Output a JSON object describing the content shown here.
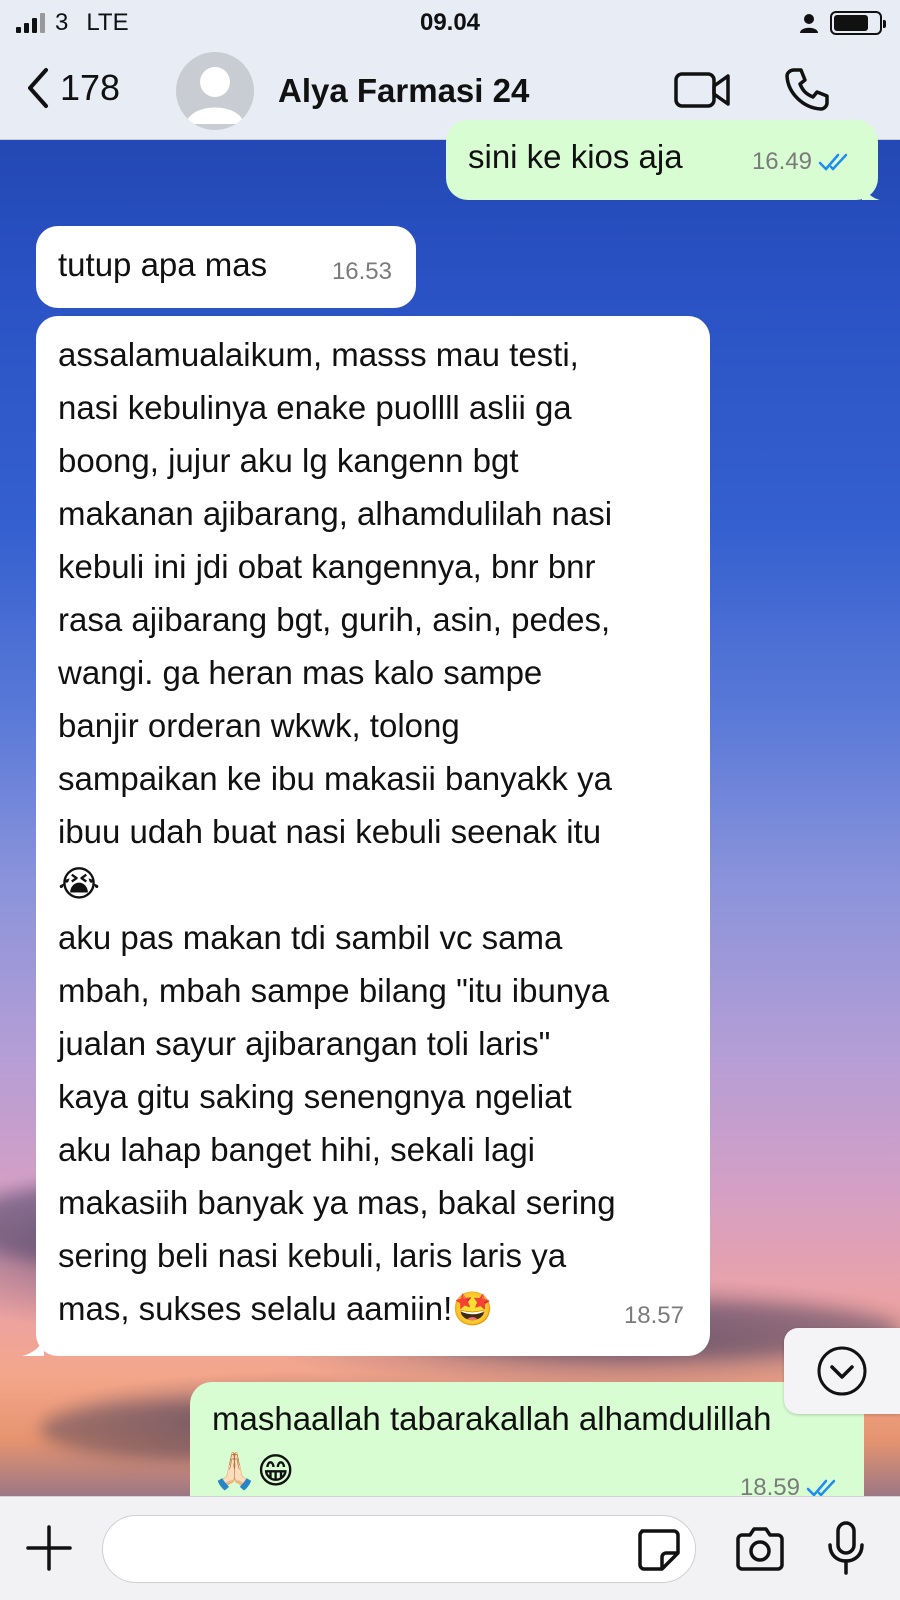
{
  "status_bar": {
    "carrier": "3",
    "network": "LTE",
    "time": "09.04"
  },
  "header": {
    "back_count": "178",
    "contact_name": "Alya Farmasi 24"
  },
  "messages": [
    {
      "direction": "outgoing",
      "text": "sini ke kios aja",
      "time": "16.49",
      "read": true
    },
    {
      "direction": "incoming",
      "text": "tutup apa mas",
      "time": "16.53"
    },
    {
      "direction": "incoming",
      "text_lines": [
        "assalamualaikum, masss mau testi,",
        "nasi kebulinya enake puollll aslii ga",
        "boong, jujur aku lg kangenn bgt",
        "makanan ajibarang, alhamdulilah nasi",
        "kebuli ini jdi obat kangennya, bnr bnr",
        "rasa ajibarang bgt, gurih, asin, pedes,",
        "wangi. ga heran mas kalo sampe",
        "banjir orderan wkwk, tolong",
        "sampaikan ke ibu makasii banyakk ya",
        "ibuu udah buat nasi kebuli seenak itu",
        "😭",
        "aku pas makan tdi sambil vc sama",
        "mbah, mbah sampe bilang \"itu ibunya",
        "jualan sayur ajibarangan toli laris\"",
        "kaya gitu saking senengnya ngeliat",
        "aku lahap banget hihi, sekali lagi",
        "makasiih banyak ya mas, bakal sering",
        "sering beli nasi kebuli, laris laris ya",
        "mas, sukses selalu aamiin!🤩"
      ],
      "time": "18.57"
    },
    {
      "direction": "outgoing",
      "text_lines": [
        "mashaallah tabarakallah alhamdulillah",
        "🙏🏻😁"
      ],
      "time": "18.59",
      "read": true
    }
  ],
  "input": {
    "placeholder": ""
  },
  "colors": {
    "outgoing_bubble": "#d9fdd3",
    "incoming_bubble": "#ffffff",
    "read_tick": "#1f8cf0",
    "bar_background": "#e8ecf4"
  },
  "icons": [
    "signal-icon",
    "person-icon",
    "battery-icon",
    "back-chevron-icon",
    "avatar-placeholder-icon",
    "video-call-icon",
    "phone-call-icon",
    "double-check-icon",
    "chevron-down-icon",
    "plus-icon",
    "sticker-icon",
    "camera-icon",
    "microphone-icon"
  ]
}
